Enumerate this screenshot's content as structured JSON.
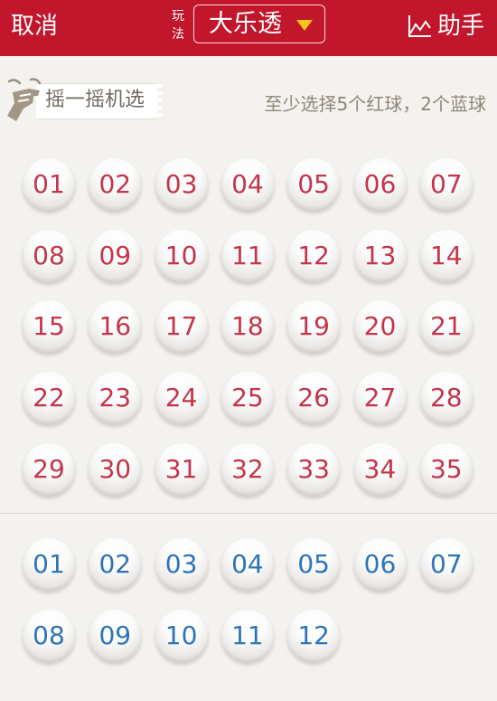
{
  "header": {
    "cancel_label": "取消",
    "play_label": "玩法",
    "game_name": "大乐透",
    "helper_label": "助手",
    "background_color": "#c2162c",
    "dropdown_color": "#f6c31c"
  },
  "toolbar": {
    "shake_label": "摇一摇机选",
    "hint": "至少选择5个红球，2个蓝球"
  },
  "red_balls": [
    "01",
    "02",
    "03",
    "04",
    "05",
    "06",
    "07",
    "08",
    "09",
    "10",
    "11",
    "12",
    "13",
    "14",
    "15",
    "16",
    "17",
    "18",
    "19",
    "20",
    "21",
    "22",
    "23",
    "24",
    "25",
    "26",
    "27",
    "28",
    "29",
    "30",
    "31",
    "32",
    "33",
    "34",
    "35"
  ],
  "blue_balls": [
    "01",
    "02",
    "03",
    "04",
    "05",
    "06",
    "07",
    "08",
    "09",
    "10",
    "11",
    "12"
  ],
  "colors": {
    "red_number": "#c5344a",
    "blue_number": "#2d74b8"
  }
}
